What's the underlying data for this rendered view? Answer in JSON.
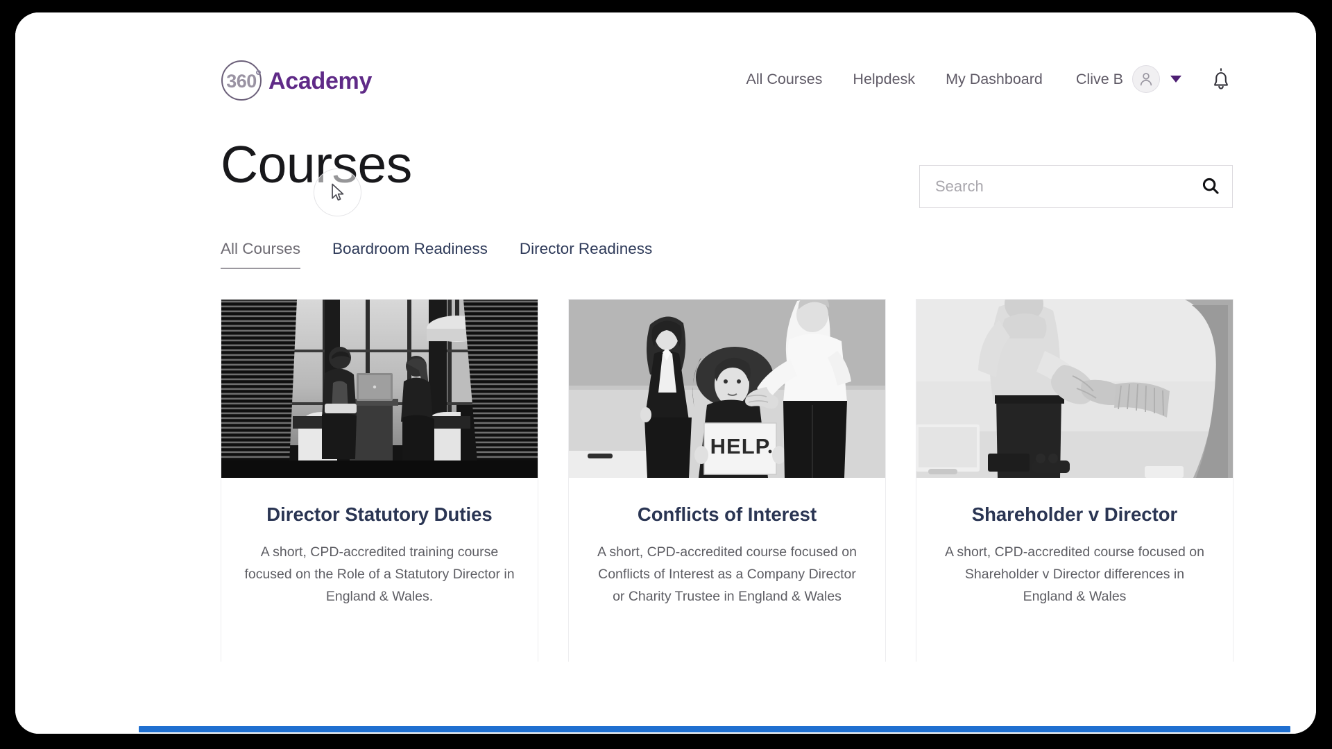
{
  "brand": {
    "mark_number": "360",
    "name": "Academy"
  },
  "header": {
    "nav": [
      {
        "label": "All Courses",
        "name": "nav-all-courses"
      },
      {
        "label": "Helpdesk",
        "name": "nav-helpdesk"
      },
      {
        "label": "My Dashboard",
        "name": "nav-my-dashboard"
      }
    ],
    "user": {
      "name": "Clive B",
      "avatar_icon": "user-avatar-icon",
      "caret_icon": "chevron-down-icon"
    },
    "notifications_icon": "bell-icon"
  },
  "page": {
    "title": "Courses"
  },
  "search": {
    "placeholder": "Search",
    "value": "",
    "icon": "search-icon"
  },
  "tabs": [
    {
      "label": "All Courses",
      "active": true
    },
    {
      "label": "Boardroom Readiness",
      "active": false
    },
    {
      "label": "Director Readiness",
      "active": false
    }
  ],
  "courses": [
    {
      "title": "Director Statutory Duties",
      "description": "A short, CPD-accredited training course focused on the Role of a Statutory Director in England & Wales.",
      "image_alt": "two colleagues meeting with a laptop by large office windows"
    },
    {
      "title": "Conflicts of Interest",
      "description": "A short, CPD-accredited course focused on Conflicts of Interest as a Company Director or Charity Trustee in England & Wales",
      "image_alt": "three colleagues in an office, seated woman holding a HELP sign"
    },
    {
      "title": "Shareholder v Director",
      "description": "A short, CPD-accredited course focused on Shareholder v Director differences in England & Wales",
      "image_alt": "two people shaking hands across a desk"
    }
  ],
  "colors": {
    "brand_purple": "#5f2a87",
    "title_navy": "#2a3553",
    "accent_blue": "#1f6fd0",
    "frame_black": "#000000"
  },
  "cursor": {
    "icon": "mouse-pointer-icon"
  }
}
